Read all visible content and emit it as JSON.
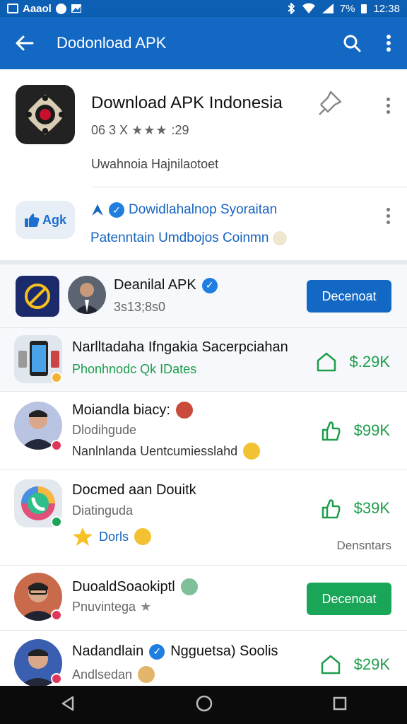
{
  "status_bar": {
    "left_text": "Аaaol",
    "time": "12:38",
    "battery": "7%"
  },
  "app_bar": {
    "title": "Dodonload APK"
  },
  "app": {
    "title": "Download APK Indonesia",
    "meta_prefix": "06 3 X",
    "stars": "★★★",
    "meta_suffix": ":29",
    "subtitle": "Uwahnoia Hajnilaotoet"
  },
  "promo": {
    "icon_label": "Agk",
    "line1": "Dowidlahalnop Syoraitan",
    "line2": "Patenntain Umdbojos Coinmn"
  },
  "list": {
    "header": {
      "title": "Deanilal APK",
      "subtitle": "3s13;8s0",
      "button": "Decenoat"
    },
    "rows": [
      {
        "title": "Narlltadaha Ifngakia Sacerpciahan",
        "subtitle": "Phonhnodc Qk IDates",
        "price": "$.29K"
      },
      {
        "title": "Moiandla biacy:",
        "subtitle": "Dlodihgude",
        "line3": "Nanlnlanda Uentcumiesslahd",
        "price": "$99K"
      },
      {
        "title": "Docmed aan Douitk",
        "subtitle": "Diatinguda",
        "line3": "Dorls",
        "price": "$39K",
        "side": "Densntars"
      },
      {
        "title": "DuoaldSoaokiptl",
        "subtitle": "Pnuvintega",
        "button": "Decenoat"
      },
      {
        "title": "Nadandlain",
        "title_b": "Ngguetsa) Soolis",
        "subtitle": "Andlsedan",
        "price": "$29K"
      }
    ]
  },
  "colors": {
    "primary": "#1368c4",
    "green": "#1e9d4b",
    "button_green": "#1aa658"
  }
}
